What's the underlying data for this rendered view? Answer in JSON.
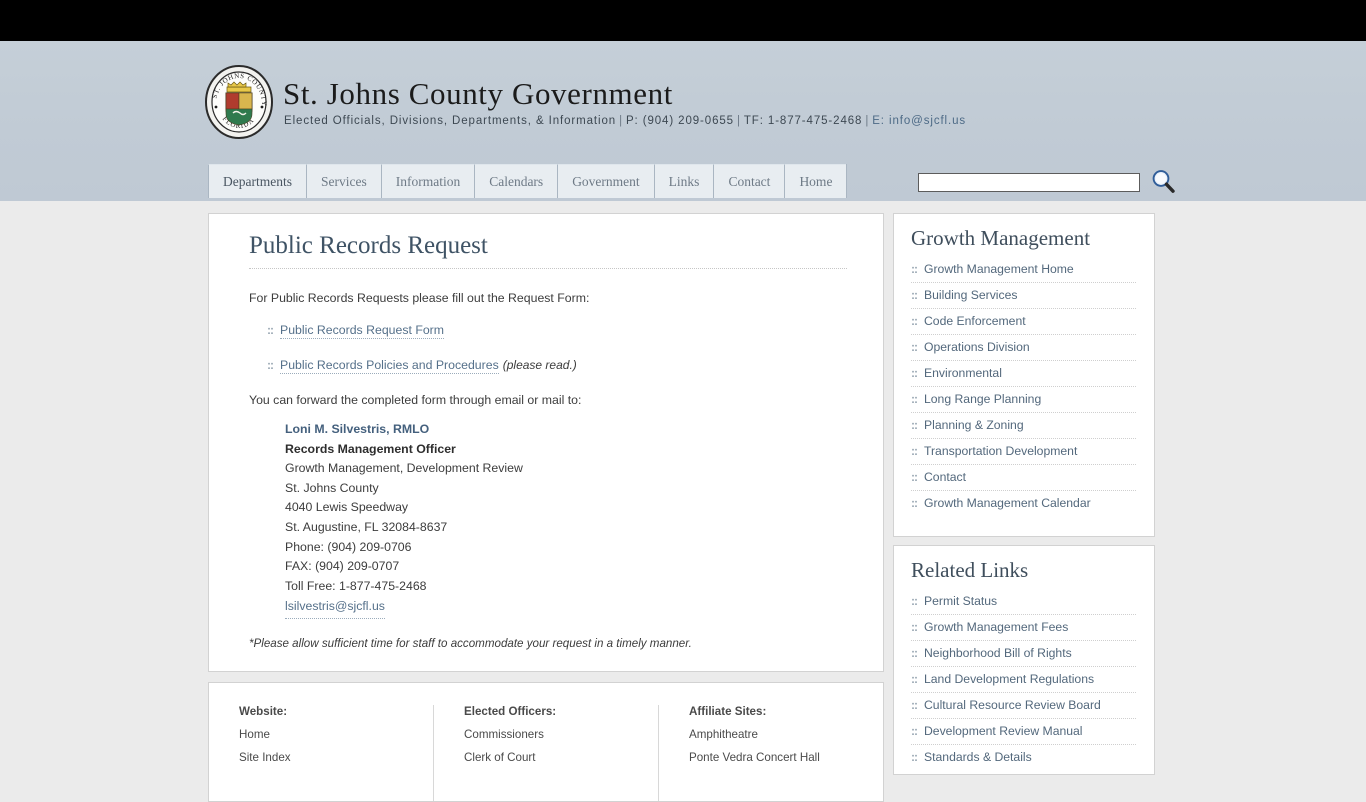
{
  "header": {
    "logo_alt": "St. Johns County Florida seal",
    "title": "St. Johns County Government",
    "tagline_text": "Elected Officials, Divisions, Departments, & Information",
    "phone": "P: (904) 209-0655",
    "toll_free": "TF: 1-877-475-2468",
    "email_label": "E: info@sjcfl.us",
    "separator": "|"
  },
  "nav": {
    "items": [
      {
        "label": "Departments"
      },
      {
        "label": "Services"
      },
      {
        "label": "Information"
      },
      {
        "label": "Calendars"
      },
      {
        "label": "Government"
      },
      {
        "label": "Links"
      },
      {
        "label": "Contact"
      },
      {
        "label": "Home"
      }
    ]
  },
  "search": {
    "value": "",
    "placeholder": "",
    "icon": "search-icon"
  },
  "main": {
    "page_title": "Public Records Request",
    "intro": "For Public Records Requests please fill out the Request Form:",
    "bullet": "::",
    "links": [
      {
        "label": "Public Records Request Form",
        "note": ""
      },
      {
        "label": "Public Records Policies and Procedures",
        "note": "(please read.)"
      }
    ],
    "forward_line": "You can forward the completed form through email or mail to:",
    "address": {
      "name": "Loni M. Silvestris, RMLO",
      "role": "Records Management Officer",
      "line1": "Growth Management, Development Review",
      "line2": "St. Johns County",
      "line3": "4040 Lewis Speedway",
      "line4": "St. Augustine, FL 32084-8637",
      "phone": "Phone: (904) 209-0706",
      "fax": "FAX: (904) 209-0707",
      "toll_free": "Toll Free: 1-877-475-2468",
      "email": "lsilvestris@sjcfl.us"
    },
    "disclaimer": "*Please allow sufficient time for staff to accommodate your request in a timely manner."
  },
  "footer": {
    "columns": [
      {
        "heading": "Website:",
        "links": [
          {
            "label": "Home"
          },
          {
            "label": "Site Index"
          }
        ]
      },
      {
        "heading": "Elected Officers:",
        "links": [
          {
            "label": "Commissioners"
          },
          {
            "label": "Clerk of Court"
          }
        ]
      },
      {
        "heading": "Affiliate Sites:",
        "links": [
          {
            "label": "Amphitheatre"
          },
          {
            "label": "Ponte Vedra Concert Hall"
          }
        ]
      }
    ]
  },
  "sidebar": {
    "bullet": "::",
    "panels": [
      {
        "title": "Growth Management",
        "items": [
          {
            "label": "Growth Management Home"
          },
          {
            "label": "Building Services"
          },
          {
            "label": "Code Enforcement"
          },
          {
            "label": "Operations Division"
          },
          {
            "label": "Environmental"
          },
          {
            "label": "Long Range Planning"
          },
          {
            "label": "Planning & Zoning"
          },
          {
            "label": "Transportation Development"
          },
          {
            "label": "Contact"
          },
          {
            "label": "Growth Management Calendar"
          }
        ]
      },
      {
        "title": "Related Links",
        "items": [
          {
            "label": "Permit Status"
          },
          {
            "label": "Growth Management Fees"
          },
          {
            "label": "Neighborhood Bill of Rights"
          },
          {
            "label": "Land Development Regulations"
          },
          {
            "label": "Cultural Resource Review Board"
          },
          {
            "label": "Development Review Manual"
          },
          {
            "label": "Standards & Details"
          }
        ]
      }
    ]
  },
  "colors": {
    "header_band": "#c3cdd7",
    "link": "#55708a",
    "heading": "#3f5365",
    "page_bg": "#ebebeb",
    "topbar": "#000000"
  }
}
